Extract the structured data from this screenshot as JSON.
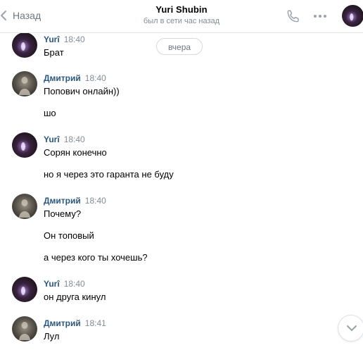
{
  "header": {
    "back_label": "Назад",
    "contact_name": "Yuri Shubin",
    "contact_status": "был в сети час назад"
  },
  "date_divider": "вчера",
  "messages": [
    {
      "author": "Yurî",
      "time": "18:40",
      "lines": [
        "Брат"
      ]
    },
    {
      "author": "Дмитрий",
      "time": "18:40",
      "lines": [
        "Попович онлайн))",
        "шо"
      ]
    },
    {
      "author": "Yurî",
      "time": "18:40",
      "lines": [
        "Сорян конечно",
        "но я через это гаранта не буду"
      ]
    },
    {
      "author": "Дмитрий",
      "time": "18:40",
      "lines": [
        "Почему?",
        "Он топовый",
        "а через кого ты хочешь?"
      ]
    },
    {
      "author": "Yurî",
      "time": "18:40",
      "lines": [
        "он друга кинул"
      ]
    },
    {
      "author": "Дмитрий",
      "time": "18:41",
      "lines": [
        "Лул"
      ]
    }
  ],
  "icons": {
    "back": "chevron-left-icon",
    "call": "phone-icon",
    "more": "more-dots-icon",
    "scroll": "chevron-down-icon"
  },
  "colors": {
    "author_name": "#2a5885",
    "meta_gray": "#818c99",
    "header_border": "#e3e4e8"
  }
}
